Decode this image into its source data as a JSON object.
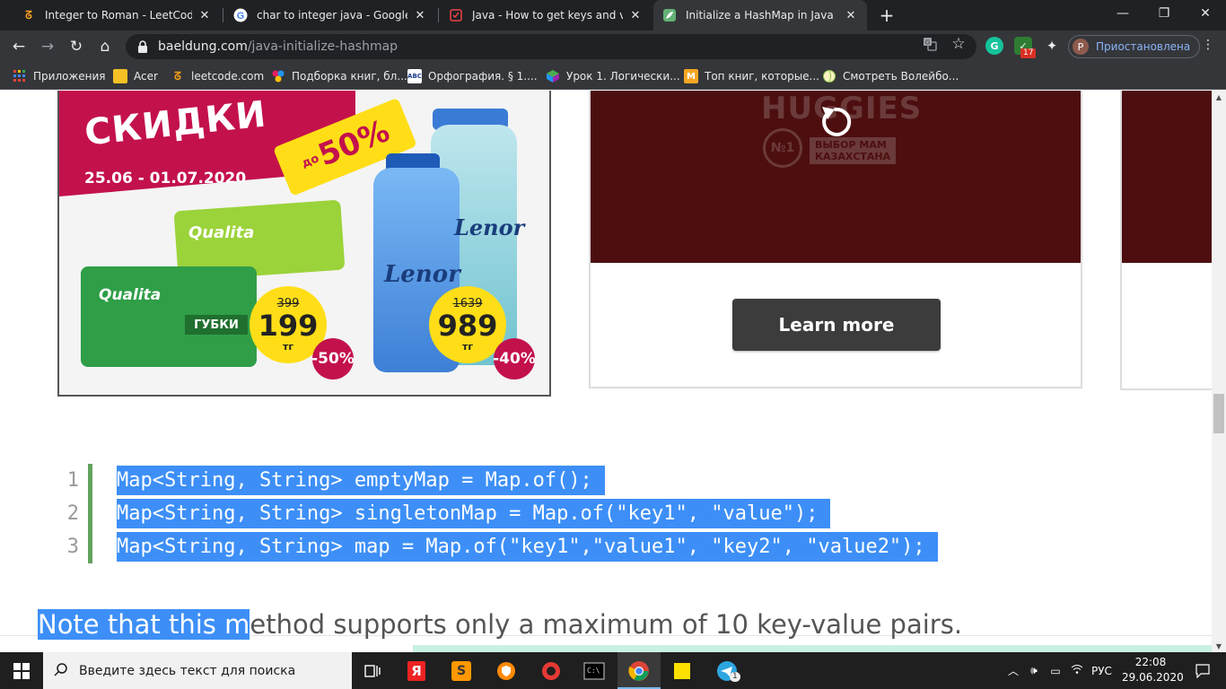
{
  "browser": {
    "tabs": [
      {
        "label": "Integer to Roman - LeetCode",
        "icon": "leetcode-icon",
        "close": "✕",
        "active": false
      },
      {
        "label": "char to integer java - Google Sea",
        "icon": "google-icon",
        "close": "✕",
        "active": false
      },
      {
        "label": "Java - How to get keys and value",
        "icon": "java-icon",
        "close": "✕",
        "active": false
      },
      {
        "label": "Initialize a HashMap in Java | Bae",
        "icon": "baeldung-icon",
        "close": "✕",
        "active": true
      }
    ],
    "new_tab": "+",
    "window_controls": {
      "minimize": "—",
      "restore": "❐",
      "close": "✕"
    },
    "toolbar": {
      "back": "←",
      "forward": "→",
      "reload": "↻",
      "home": "⌂",
      "url_host": "baeldung.com",
      "url_path": "/java-initialize-hashmap",
      "translate_icon": "translate-icon",
      "star": "☆",
      "extension_badge": "17",
      "profile_initial": "P",
      "profile_label": "Приостановлена",
      "menu": "⋮"
    },
    "bookmarks": [
      {
        "label": "Приложения",
        "icon": "apps-icon"
      },
      {
        "label": "Acer",
        "icon": "folder-icon"
      },
      {
        "label": "leetcode.com",
        "icon": "leetcode-icon"
      },
      {
        "label": "Подборка книг, бл...",
        "icon": "colorful-icon"
      },
      {
        "label": "Орфография. § 1....",
        "icon": "abc-icon"
      },
      {
        "label": "Урок 1. Логически...",
        "icon": "cube-icon"
      },
      {
        "label": "Топ книг, которые...",
        "icon": "m-icon"
      },
      {
        "label": "Смотреть Волейбо...",
        "icon": "volleyball-icon"
      }
    ]
  },
  "ads": {
    "ad1": {
      "headline": "СКИДКИ",
      "dates": "25.06 - 01.07.2020",
      "tag_prefix": "до",
      "tag_value": "50%",
      "brand1": "Qualita",
      "brand1_label": "ГУБКИ",
      "brand2": "Lenor",
      "price1_old": "399",
      "price1_new": "199",
      "price2_old": "1639",
      "price2_new": "989",
      "currency": "тг",
      "discount1": "-50%",
      "discount2": "-40%"
    },
    "ad2": {
      "logo": "HUGGIES",
      "seal": "№1",
      "seal_text": "ВЫБОР МАМ КАЗАХСТАНА",
      "button": "Learn more"
    }
  },
  "article": {
    "code_lines": [
      {
        "num": "1",
        "text": "Map<String, String> emptyMap = Map.of();"
      },
      {
        "num": "2",
        "text": "Map<String, String> singletonMap = Map.of(\"key1\", \"value\");"
      },
      {
        "num": "3",
        "text": "Map<String, String> map = Map.of(\"key1\",\"value1\", \"key2\", \"value2\");"
      }
    ],
    "note_selected": "Note that this m",
    "note_rest": "ethod supports only a maximum of 10 key-value pairs."
  },
  "taskbar": {
    "search_placeholder": "Введите здесь текст для поиска",
    "language": "РУС",
    "time": "22:08",
    "date": "29.06.2020",
    "telegram_badge": "1"
  },
  "colors": {
    "selection": "#3d8ff7",
    "gutter": "#63a35c",
    "ad_pink": "#c3114c",
    "ad_yellow": "#ffde17",
    "huggies_bg": "#4d0e10"
  }
}
